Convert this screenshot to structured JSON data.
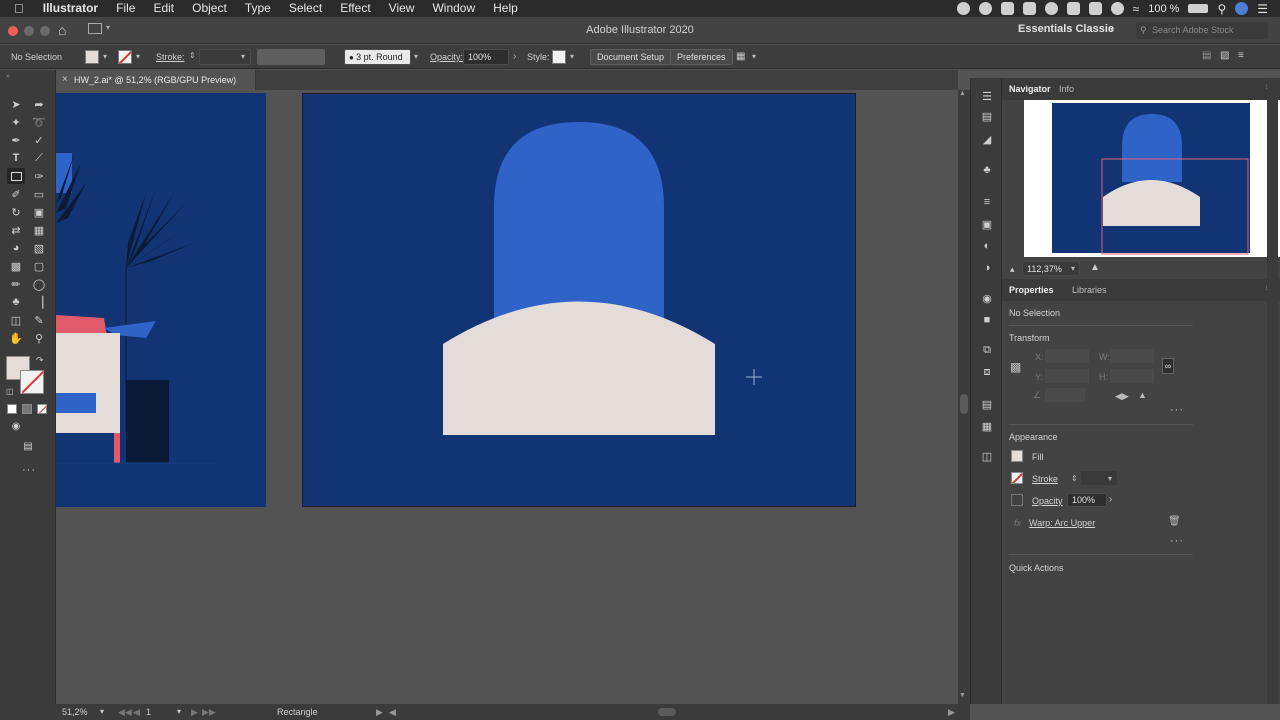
{
  "menubar": {
    "app_name": "Illustrator",
    "items": [
      "File",
      "Edit",
      "Object",
      "Type",
      "Select",
      "Effect",
      "View",
      "Window",
      "Help"
    ],
    "battery": "100 %"
  },
  "appbar": {
    "title": "Adobe Illustrator 2020",
    "workspace": "Essentials Classic",
    "search_placeholder": "Search Adobe Stock"
  },
  "control_bar": {
    "selection": "No Selection",
    "stroke_label": "Stroke:",
    "brush": "3 pt. Round",
    "opacity_label": "Opacity:",
    "opacity_value": "100%",
    "style_label": "Style:",
    "document_setup": "Document Setup",
    "preferences": "Preferences"
  },
  "document_tab": {
    "close_glyph": "×",
    "title": "HW_2.ai* @ 51,2% (RGB/GPU Preview)"
  },
  "navigator": {
    "tabs": [
      "Navigator",
      "Info"
    ],
    "zoom": "112,37%"
  },
  "properties": {
    "tabs": [
      "Properties",
      "Libraries"
    ],
    "selection": "No Selection",
    "transform_title": "Transform",
    "x_label": "X:",
    "y_label": "Y:",
    "w_label": "W:",
    "h_label": "H:",
    "appearance_title": "Appearance",
    "fill_label": "Fill",
    "stroke_label": "Stroke",
    "opacity_label": "Opacity",
    "opacity_value": "100%",
    "effect_name": "Warp: Arc Upper",
    "quick_actions_title": "Quick Actions"
  },
  "status_bar": {
    "zoom": "51,2%",
    "artboard_number": "1",
    "tool_name": "Rectangle"
  },
  "colors": {
    "artboard": "#123474",
    "arch_blue": "#2f63c8",
    "cream": "#e3dcd8",
    "pink": "#e05a6a",
    "dark_navy": "#0b1a36",
    "menubar": "#2b2b2b",
    "panel": "#434343"
  },
  "icons": {
    "stroke_swatch": "stroke-none-icon",
    "fx": "fx-icon",
    "trash": "trash-icon"
  }
}
